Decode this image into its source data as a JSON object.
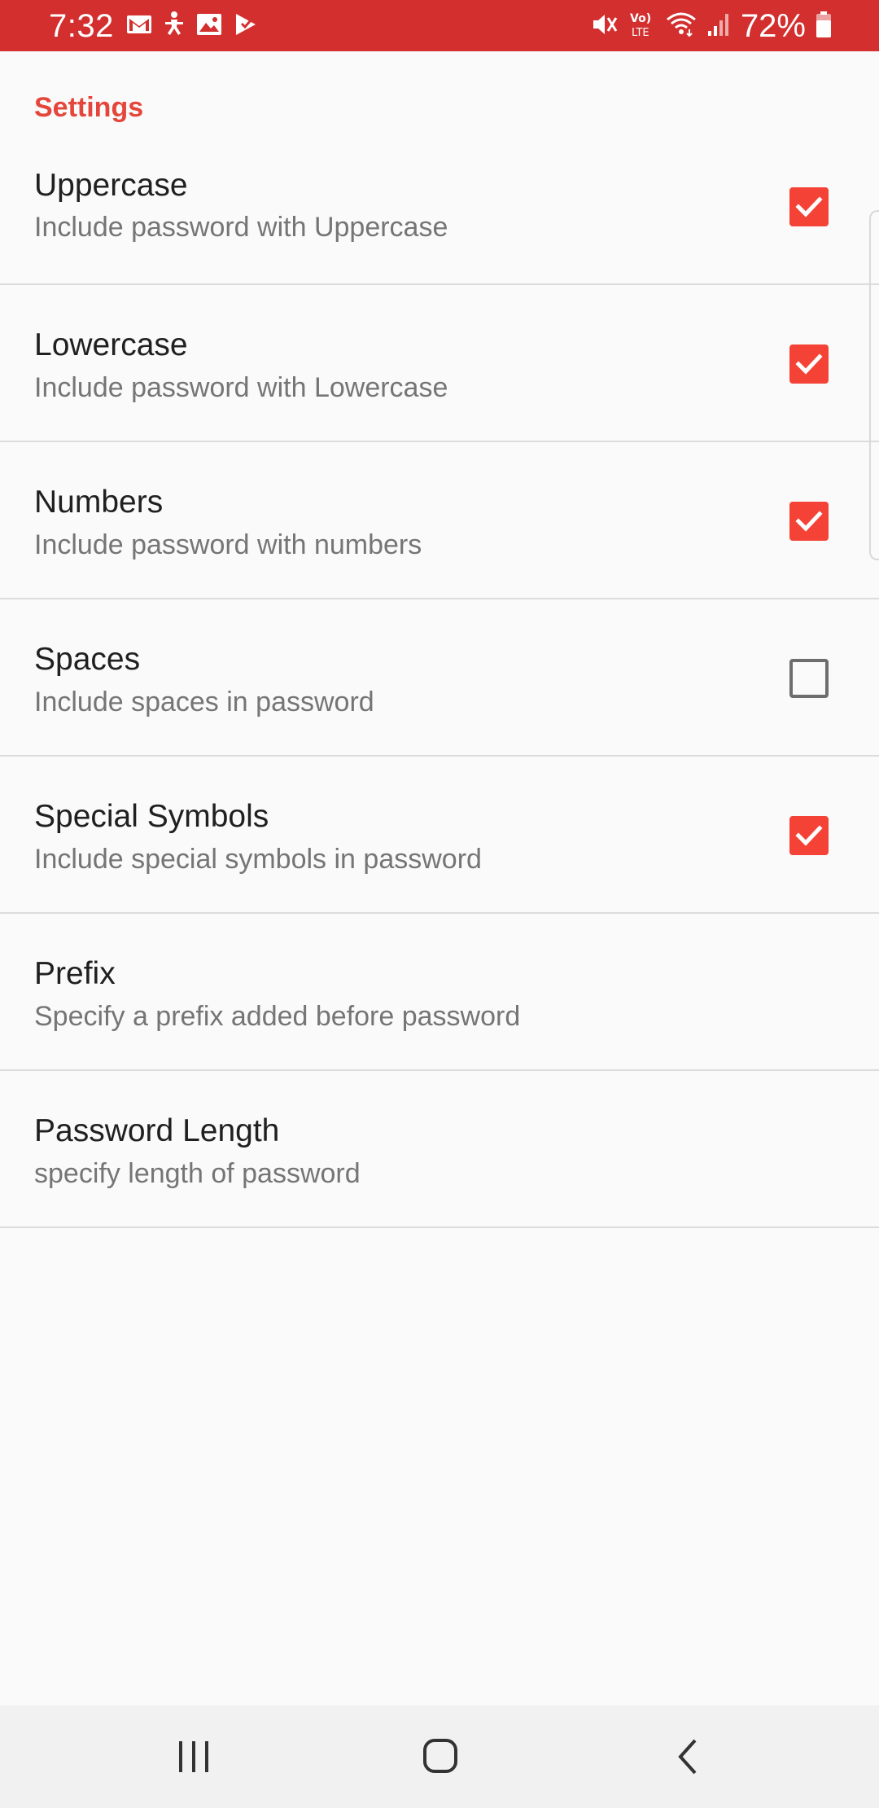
{
  "status_bar": {
    "time": "7:32",
    "battery_percent": "72%",
    "left_icons": [
      "gmail-icon",
      "accessibility-icon",
      "gallery-icon",
      "play-store-icon"
    ],
    "right_icons": [
      "mute-icon",
      "volte-icon",
      "wifi-icon",
      "signal-icon",
      "battery-icon"
    ],
    "color": "#d32f2f"
  },
  "settings": {
    "section_title": "Settings",
    "accent_color": "#e5463b",
    "items": [
      {
        "title": "Uppercase",
        "summary": "Include password with Uppercase",
        "checkbox": true,
        "checked": true
      },
      {
        "title": "Lowercase",
        "summary": "Include password with Lowercase",
        "checkbox": true,
        "checked": true
      },
      {
        "title": "Numbers",
        "summary": "Include password with numbers",
        "checkbox": true,
        "checked": true
      },
      {
        "title": "Spaces",
        "summary": "Include spaces in password",
        "checkbox": true,
        "checked": false
      },
      {
        "title": "Special Symbols",
        "summary": "Include special symbols in password",
        "checkbox": true,
        "checked": true
      },
      {
        "title": "Prefix",
        "summary": "Specify a prefix added before password",
        "checkbox": false
      },
      {
        "title": "Password Length",
        "summary": "specify length of password",
        "checkbox": false
      }
    ]
  },
  "nav_bar": {
    "buttons": [
      "recents-icon",
      "home-icon",
      "back-icon"
    ]
  }
}
